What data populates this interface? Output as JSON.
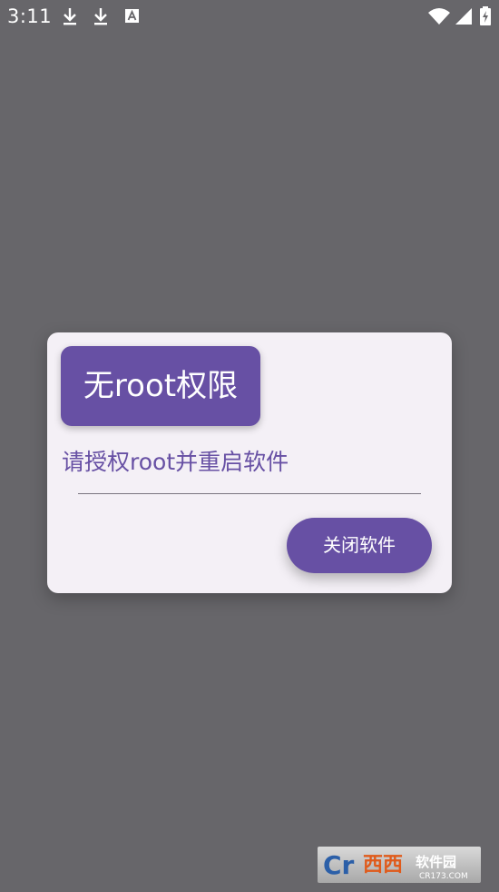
{
  "status_bar": {
    "time": "3:11",
    "icons": [
      "download-icon",
      "download-icon",
      "font-notification-icon",
      "wifi-icon",
      "signal-icon",
      "battery-icon"
    ]
  },
  "dialog": {
    "title": "无root权限",
    "message": "请授权root并重启软件",
    "button_label": "关闭软件"
  },
  "watermark": {
    "logo_text": "Cr西西软件园",
    "url": "CR173.COM"
  },
  "colors": {
    "background": "#67666a",
    "dialog_bg": "#f4f0f6",
    "accent": "#6750a4"
  }
}
